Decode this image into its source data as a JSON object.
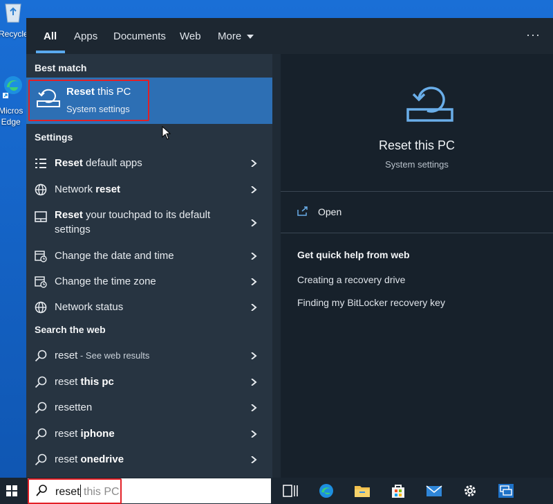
{
  "desktop": {
    "icons": [
      {
        "label": "Recycle",
        "name": "recycle-bin-icon"
      },
      {
        "label": "Micros\nEdge",
        "name": "microsoft-edge-icon"
      }
    ]
  },
  "tabs": [
    {
      "label": "All"
    },
    {
      "label": "Apps"
    },
    {
      "label": "Documents"
    },
    {
      "label": "Web"
    },
    {
      "label": "More"
    }
  ],
  "sections": {
    "best_match": "Best match",
    "settings": "Settings",
    "search_web": "Search the web"
  },
  "best_match": {
    "title_bold": "Reset",
    "title_rest": " this PC",
    "subtitle": "System settings"
  },
  "settings_items": [
    {
      "bold": "Reset",
      "rest": " default apps",
      "icon": "list-icon"
    },
    {
      "pre": "Network ",
      "bold": "reset",
      "icon": "globe-icon"
    },
    {
      "bold": "Reset",
      "rest": " your touchpad to its default settings",
      "icon": "touchpad-icon"
    },
    {
      "pre": "Change the date and time",
      "icon": "calendar-clock-icon"
    },
    {
      "pre": "Change the time zone",
      "icon": "calendar-clock-icon"
    },
    {
      "pre": "Network status",
      "icon": "globe-icon"
    }
  ],
  "web_items": [
    {
      "pre": "reset",
      "muted": " - See web results"
    },
    {
      "pre": "reset ",
      "bold": "this pc"
    },
    {
      "pre": "resetten"
    },
    {
      "pre": "reset ",
      "bold": "iphone"
    },
    {
      "pre": "reset ",
      "bold": "onedrive"
    }
  ],
  "preview": {
    "title": "Reset this PC",
    "subtitle": "System settings",
    "open": "Open",
    "help_heading": "Get quick help from web",
    "links": [
      "Creating a recovery drive",
      "Finding my BitLocker recovery key"
    ]
  },
  "search": {
    "typed": "reset",
    "hint": " this PC"
  },
  "colors": {
    "accent": "#5aa9ee",
    "highlight": "#2d6fb4",
    "annotation": "#e21f26"
  }
}
